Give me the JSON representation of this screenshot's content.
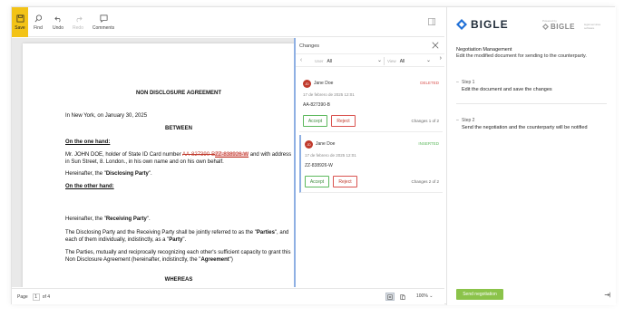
{
  "toolbar": {
    "save": "Save",
    "find": "Find",
    "undo": "Undo",
    "redo": "Redo",
    "comments": "Comments"
  },
  "document": {
    "title": "NON DISCLOSURE AGREEMENT",
    "line_place": "In New York, on January 30, 2025",
    "between": "BETWEEN",
    "one_hand": "On the one hand:",
    "p1_a": "Mr. JOHN DOE, holder of State ID Card number ",
    "p1_del": "AA-827390-B",
    "p1_ins": "ZZ-838926-W",
    "p1_b": " and with address",
    "p1_c": "in Sun Street, 8. London., in his own name and on his own behalf.",
    "hereinafter_disclosing_a": "Hereinafter, the \"",
    "disclosing_party": "Disclosing Party",
    "hereinafter_disclosing_b": "\".",
    "other_hand": "On the other hand:",
    "hereinafter_receiving_a": "Hereinafter, the \"",
    "receiving_party": "Receiving Party",
    "hereinafter_receiving_b": "\".",
    "p2_a": "The Disclosing Party and the Receiving Party shall be jointly referred to as the \"",
    "parties": "Parties",
    "p2_b": "\", and",
    "p2_c": "each of them individually, indistinctly, as a \"",
    "party": "Party",
    "p2_d": "\".",
    "p3_a": "The Parties, mutually and reciprocally recognizing each other's sufficient capacity to grant this",
    "p3_b": "Non Disclosure Agreement (hereinafter, indistinctly, the \"",
    "agreement": "Agreement",
    "p3_c": "\")",
    "whereas": "WHEREAS"
  },
  "changes": {
    "header": "Changes",
    "user_label": "User",
    "user_value": "All",
    "view_label": "View",
    "view_value": "All",
    "items": [
      {
        "initials": "JD",
        "author": "Jane Doe",
        "status": "DELETED",
        "date": "17 de febrero de 2025 12:01",
        "value": "AA-827390-B",
        "accept": "Accept",
        "reject": "Reject",
        "counter": "Changes 1 of 2"
      },
      {
        "initials": "JD",
        "author": "Jane Doe",
        "status": "INSERTED",
        "date": "17 de febrero de 2025 12:01",
        "value": "ZZ-838926-W",
        "accept": "Accept",
        "reject": "Reject",
        "counter": "Changes 2 of 2"
      }
    ]
  },
  "right": {
    "brand": "BIGLE",
    "powered_by": "Powered by",
    "powered_brand": "BIGLE",
    "powered_tag": "legal services software",
    "title": "Negotiation Management",
    "subtitle": "Edit the modified document for sending to the counterparty.",
    "step1_label": "Step 1",
    "step1_desc": "Edit the document and save the changes",
    "step2_label": "Step 2",
    "step2_desc": "Send the negotiation and the counterparty will be notified",
    "send": "Send negotiation"
  },
  "footer": {
    "page_label": "Page",
    "page_current": "1",
    "page_total": "of 4",
    "zoom": "100%"
  },
  "colors": {
    "save_accent": "#f3c316",
    "accept": "#5cb85c",
    "reject": "#d9534f",
    "send": "#8bc34a",
    "panel_accent": "#8fb0e3"
  }
}
